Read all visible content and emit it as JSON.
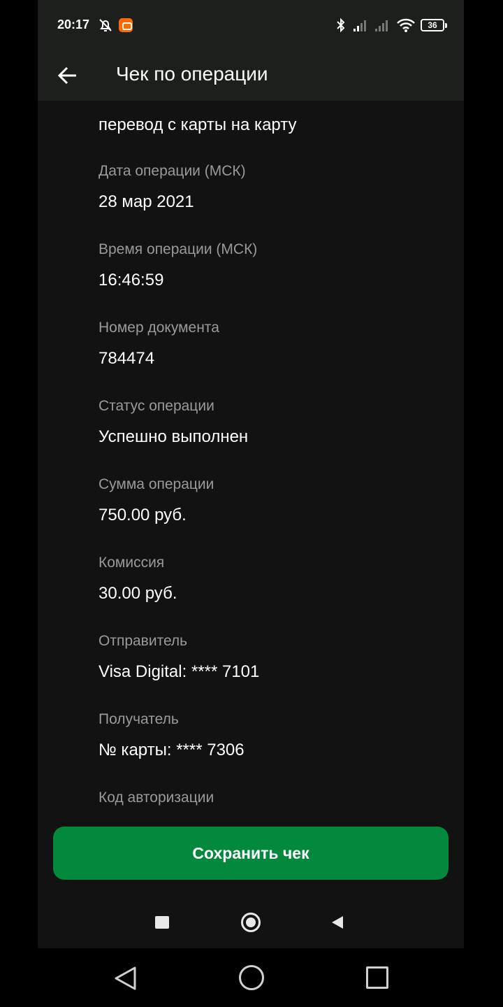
{
  "status_bar": {
    "time": "20:17",
    "battery": "36",
    "icons": [
      "mute-alarm-icon",
      "app-notification-icon",
      "bluetooth-icon",
      "signal-icon",
      "signal-icon",
      "wifi-icon",
      "battery-icon"
    ]
  },
  "header": {
    "back_icon": "arrow-left-icon",
    "title": "Чек по операции"
  },
  "receipt": {
    "operation_type": "перевод с карты на карту",
    "fields": [
      {
        "label": "Дата операции (МСК)",
        "value": "28 мар 2021"
      },
      {
        "label": "Время операции (МСК)",
        "value": "16:46:59"
      },
      {
        "label": "Номер документа",
        "value": "784474"
      },
      {
        "label": "Статус операции",
        "value": "Успешно выполнен"
      },
      {
        "label": "Сумма операции",
        "value": "750.00 руб."
      },
      {
        "label": "Комиссия",
        "value": "30.00 руб."
      },
      {
        "label": "Отправитель",
        "value": "Visa Digital: **** 7101"
      },
      {
        "label": "Получатель",
        "value": "№ карты: **** 7306"
      },
      {
        "label": "Код авторизации"
      }
    ]
  },
  "footer": {
    "save_label": "Сохранить чек"
  },
  "colors": {
    "accent": "#02893e",
    "background": "#121212",
    "header_background": "#1c1f1c",
    "label": "#9a9a9a",
    "text": "#ffffff"
  }
}
